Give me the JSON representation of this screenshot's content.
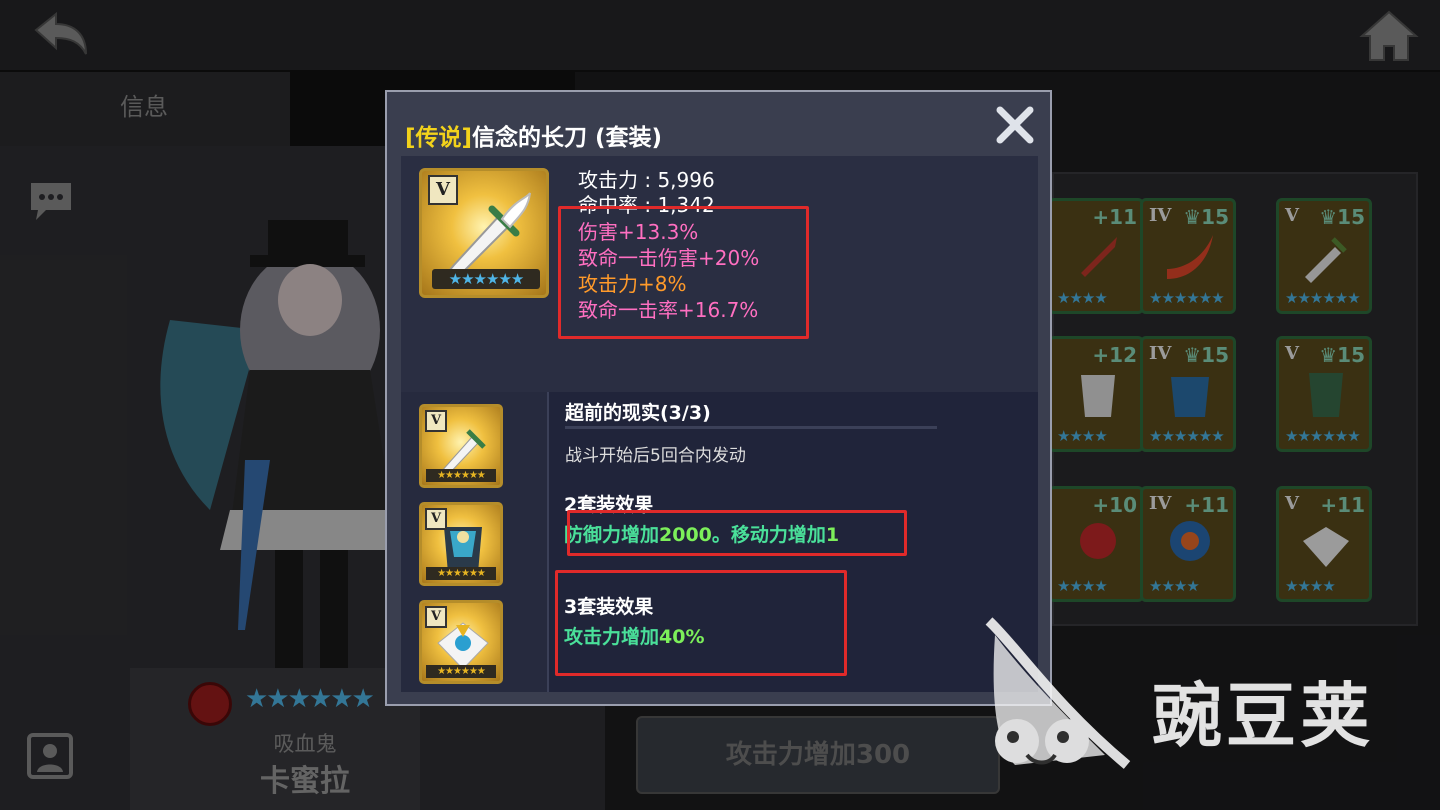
{
  "header": {
    "back_icon": "back-arrow-icon",
    "home_icon": "home-icon"
  },
  "tabs": [
    {
      "label": "信息"
    }
  ],
  "hero": {
    "class": "吸血鬼",
    "name": "卡蜜拉",
    "stars": "★★★★★★"
  },
  "inventory": [
    {
      "grade": "",
      "level": "+11"
    },
    {
      "grade": "IV",
      "level": "15"
    },
    {
      "grade": "V",
      "level": "15"
    },
    {
      "grade": "",
      "level": "+12"
    },
    {
      "grade": "IV",
      "level": "15"
    },
    {
      "grade": "V",
      "level": "15"
    },
    {
      "grade": "",
      "level": "+10"
    },
    {
      "grade": "IV",
      "level": "+11"
    },
    {
      "grade": "V",
      "level": "+11"
    }
  ],
  "background_button": "攻击力增加300",
  "modal": {
    "title_tag": "[传说]",
    "title": "信念的长刀 (套装)",
    "item": {
      "grade": "V",
      "stars": "★★★★★★"
    },
    "base_stats": [
      "攻击力 : 5,996",
      "命中率 : 1,342"
    ],
    "sub_stats": [
      {
        "text": "伤害+13.3%",
        "color": "#ff6fc1"
      },
      {
        "text": "致命一击伤害+20%",
        "color": "#ff6fc1"
      },
      {
        "text": "攻击力+8%",
        "color": "#ff9a2a"
      },
      {
        "text": "致命一击率+16.7%",
        "color": "#ff6fc1"
      }
    ],
    "set": {
      "name": "超前的现实(3/3)",
      "condition": "战斗开始后5回合内发动",
      "pieces": [
        {
          "grade": "V"
        },
        {
          "grade": "V"
        },
        {
          "grade": "V"
        }
      ],
      "effect2_title": "2套装效果",
      "effect2_a": "防御力增加",
      "effect2_a_num": "2000",
      "effect2_b": "。移动力增加",
      "effect2_b_num": "1",
      "effect3_title": "3套装效果",
      "effect3_a": "攻击力增加",
      "effect3_a_num": "40%"
    },
    "close_icon": "close-x-icon"
  },
  "watermark": {
    "text": "豌豆荚"
  },
  "colors": {
    "legend_tag": "#f2d21b",
    "set_effect": "#4ae09a",
    "highlight_box": "#e02a2a"
  }
}
